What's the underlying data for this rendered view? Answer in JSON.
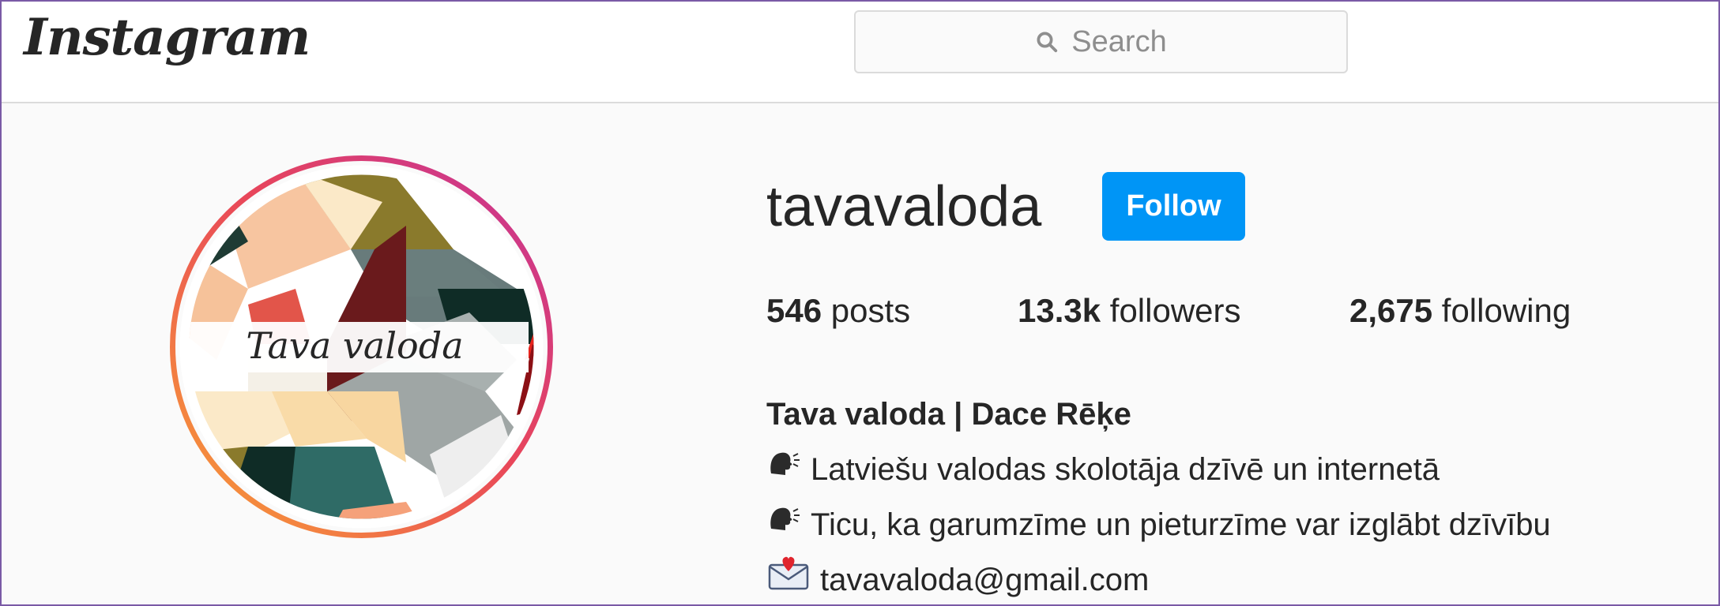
{
  "app": {
    "logo_text": "Instagram"
  },
  "search": {
    "placeholder": "Search"
  },
  "profile": {
    "username": "tavavaloda",
    "follow_label": "Follow",
    "avatar_text": "Tava valoda",
    "stats": {
      "posts_count": "546",
      "posts_label": "posts",
      "followers_count": "13.3k",
      "followers_label": "followers",
      "following_count": "2,675",
      "following_label": "following"
    },
    "bio": {
      "name": "Tava valoda | Dace Rēķe",
      "line1": "Latviešu valodas skolotāja dzīvē un internetā",
      "line2": "Ticu, ka garumzīme un pieturzīme var izglābt dzīvību",
      "email": "tavavaloda@gmail.com"
    }
  },
  "icons": {
    "search": "search-icon",
    "speaking_head": "speaking-head-icon",
    "envelope_heart": "envelope-heart-icon"
  },
  "colors": {
    "follow_button": "#0095f6",
    "story_ring_start": "#f7a234",
    "story_ring_end": "#d3318f"
  }
}
